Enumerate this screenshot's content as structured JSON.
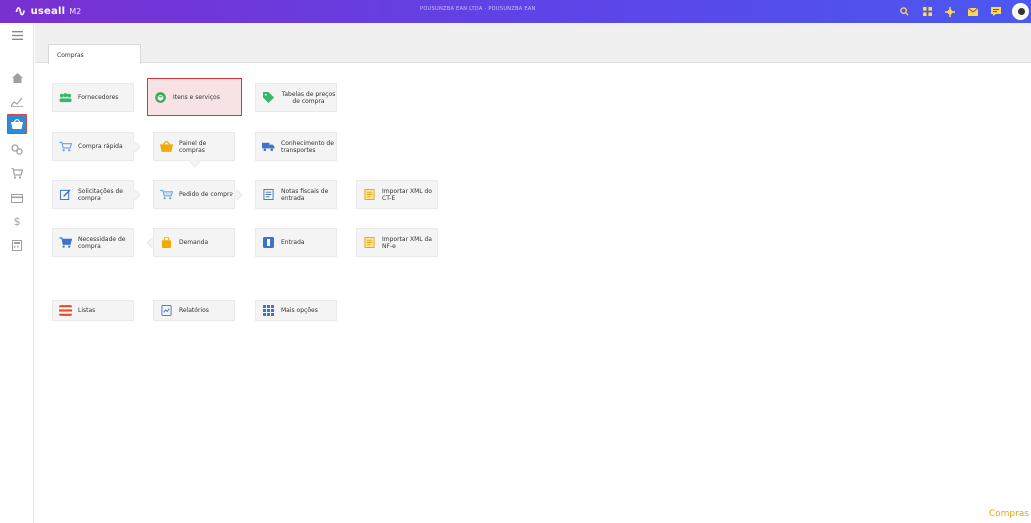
{
  "header": {
    "logo_text": "useall",
    "logo_version": "M2",
    "company": "POUSUNZBA EAN LTDA · POUSUNZBA EAN",
    "icons": [
      "search-icon",
      "apps-icon",
      "settings-icon",
      "mail-icon",
      "chat-icon",
      "avatar"
    ]
  },
  "sidebar": {
    "items": [
      "menu-icon",
      "home-icon",
      "chart-icon",
      "purchase-icon",
      "cogs-icon",
      "cart-icon",
      "card-icon",
      "dollar-icon",
      "calculator-icon"
    ],
    "active": "purchase-icon"
  },
  "tabs": [
    {
      "label": "Compras"
    }
  ],
  "tiles": {
    "fornecedores": "Fornecedores",
    "itens_servicos": "Itens e serviços",
    "tabelas_precos": "Tabelas de preços de compra",
    "compra_rapida": "Compra rápida",
    "painel_compras": "Painel de compras",
    "conhecimento_transportes": "Conhecimento de transportes",
    "solicitacoes_compra": "Solicitações de compra",
    "pedido_compra": "Pedido de compra",
    "notas_fiscais_entrada": "Notas fiscais de entrada",
    "importar_xml_cte": "Importar XML do CT-E",
    "necessidade_compra": "Necessidade de compra",
    "demanda": "Demanda",
    "entrada": "Entrada",
    "importar_xml_nfe": "Importar XML da NF-e",
    "listas": "Listas",
    "relatorios": "Relatórios",
    "mais_opcoes": "Mais opções"
  },
  "colors": {
    "accent": "#5d45e8",
    "selected_border": "#d9333d",
    "selected_bg": "#f7e2e4",
    "footer": "#e8a800"
  },
  "footer": {
    "label": "Compras"
  }
}
